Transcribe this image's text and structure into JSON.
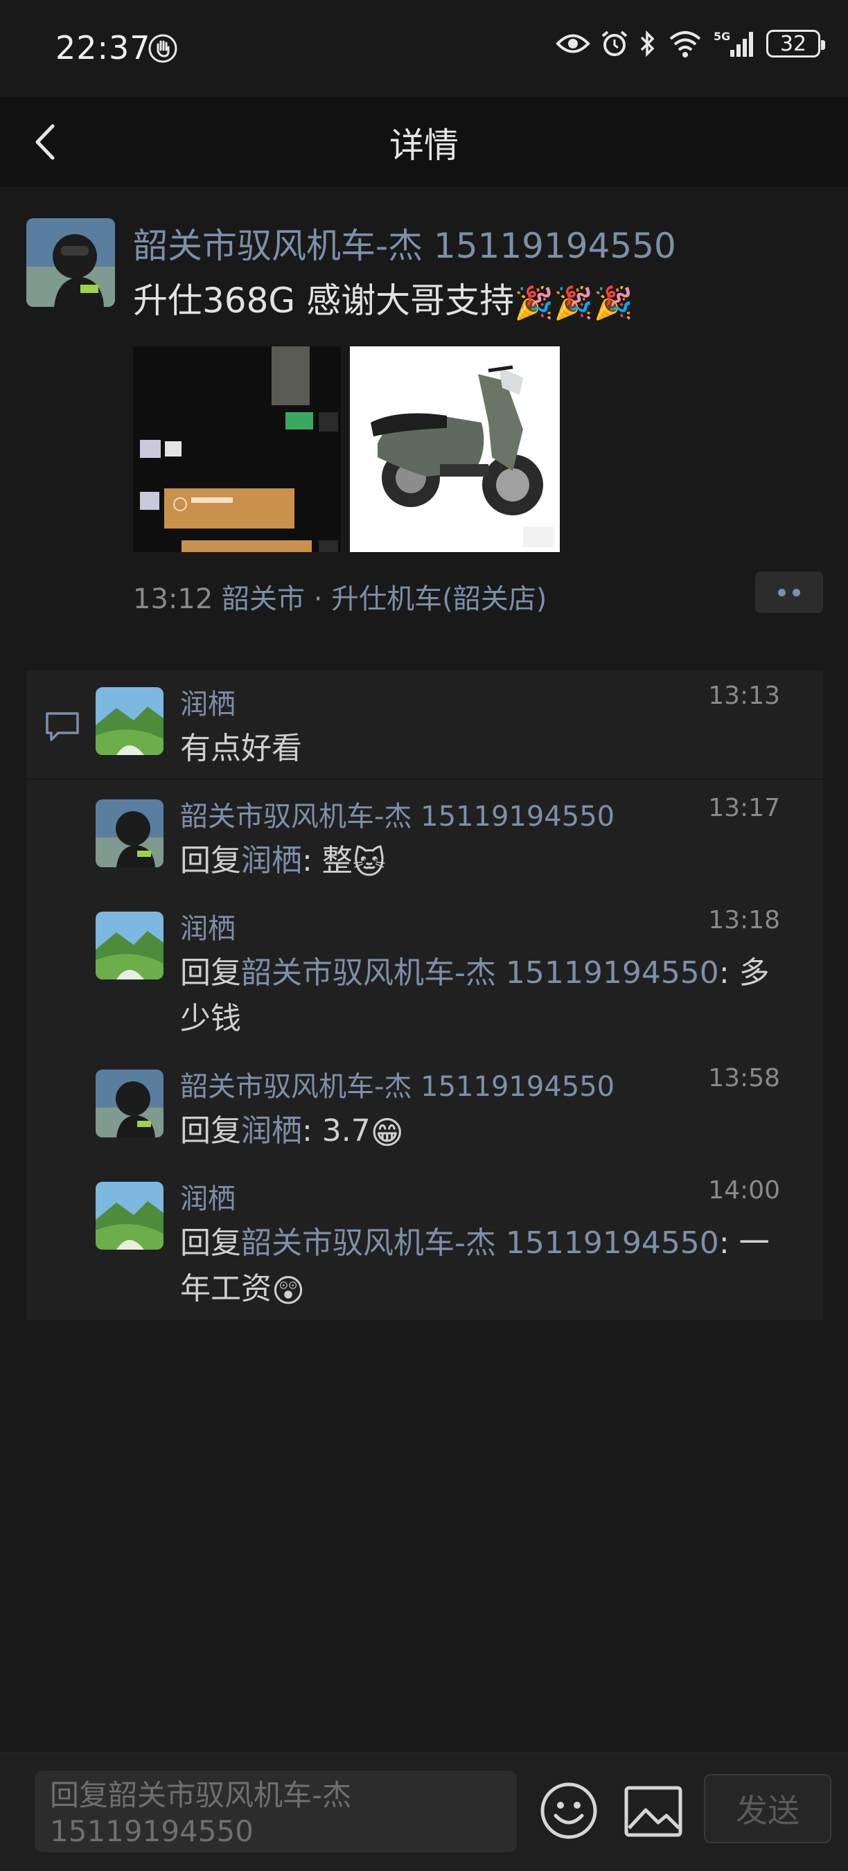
{
  "status": {
    "time": "22:37",
    "battery": "32"
  },
  "nav": {
    "title": "详情"
  },
  "post": {
    "author": "韶关市驭风机车-杰 15119194550",
    "text": "升仕368G 感谢大哥支持",
    "text_emojis": "🎉🎉🎉",
    "time": "13:12",
    "location": "韶关市 · 升仕机车(韶关店)"
  },
  "comments": [
    {
      "name": "润栖",
      "time": "13:13",
      "text": "有点好看",
      "reply_prefix": "",
      "reply_target": "",
      "reply_suffix": "",
      "emoji": ""
    },
    {
      "name": "韶关市驭风机车-杰 15119194550",
      "time": "13:17",
      "text": "",
      "reply_prefix": "回复",
      "reply_target": "润栖",
      "reply_suffix": ": 整",
      "emoji": "🐱"
    },
    {
      "name": "润栖",
      "time": "13:18",
      "text": "",
      "reply_prefix": "回复",
      "reply_target": "韶关市驭风机车-杰 15119194550",
      "reply_suffix": ": 多少钱",
      "emoji": ""
    },
    {
      "name": "韶关市驭风机车-杰 15119194550",
      "time": "13:58",
      "text": "",
      "reply_prefix": "回复",
      "reply_target": "润栖",
      "reply_suffix": ": 3.7",
      "emoji": "😁"
    },
    {
      "name": "润栖",
      "time": "14:00",
      "text": "",
      "reply_prefix": "回复",
      "reply_target": "韶关市驭风机车-杰 15119194550",
      "reply_suffix": ": 一年工资",
      "emoji": "😲"
    }
  ],
  "bottom": {
    "placeholder": "回复韶关市驭风机车-杰 15119194550",
    "send_label": "发送"
  },
  "colors": {
    "link": "#7d90a9",
    "background": "#191919"
  }
}
